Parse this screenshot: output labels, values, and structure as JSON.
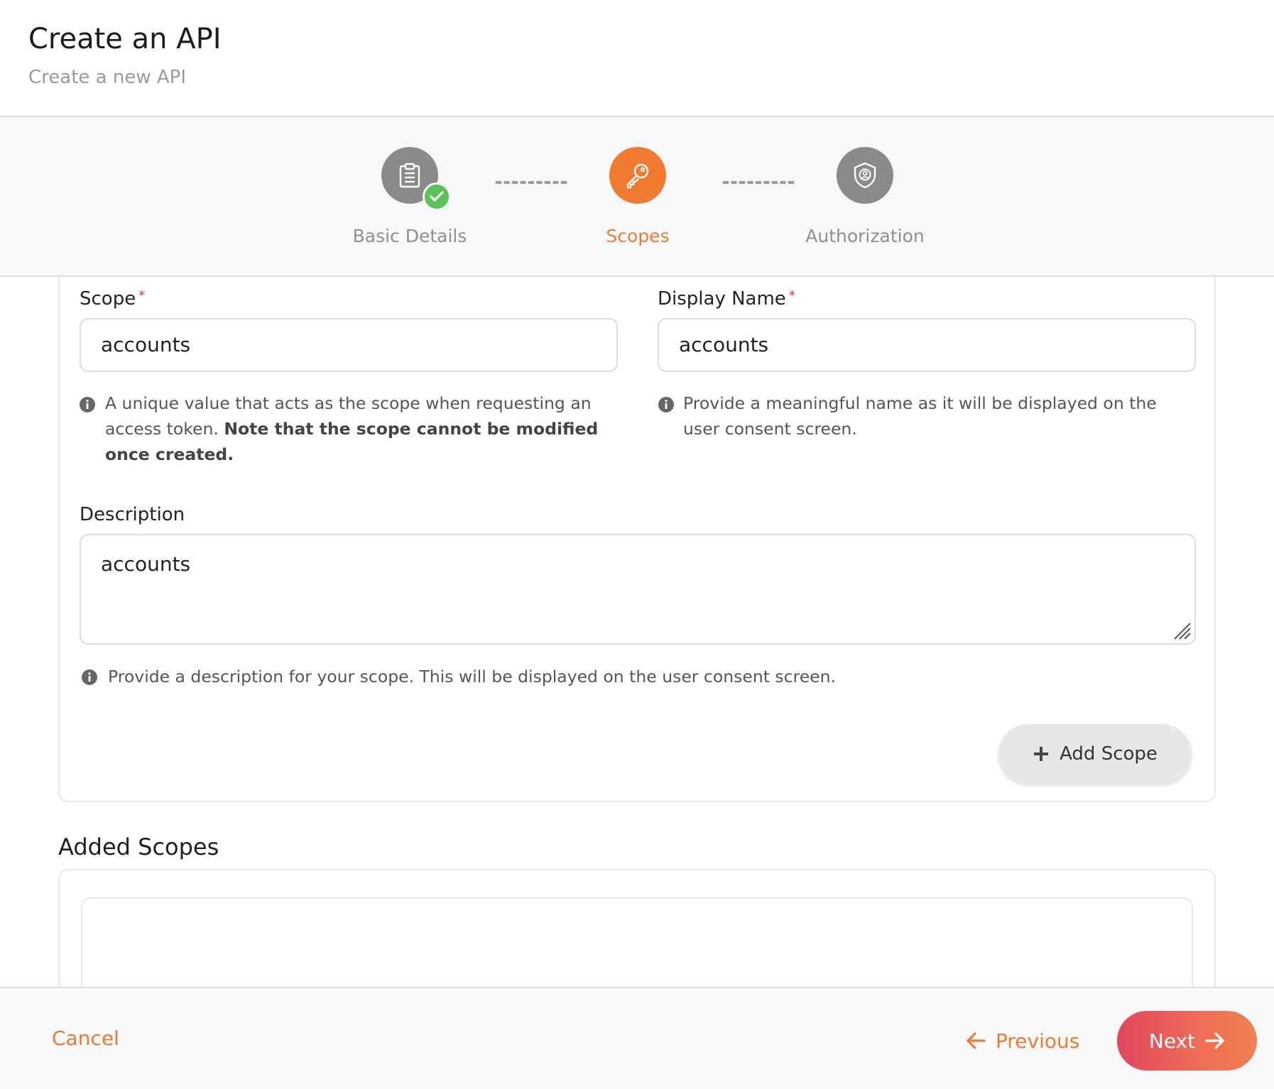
{
  "header": {
    "title": "Create an API",
    "subtitle": "Create a new API"
  },
  "stepper": {
    "steps": [
      {
        "label": "Basic Details",
        "state": "completed",
        "icon": "clipboard-icon"
      },
      {
        "label": "Scopes",
        "state": "active",
        "icon": "key-icon"
      },
      {
        "label": "Authorization",
        "state": "pending",
        "icon": "shield-user-icon"
      }
    ]
  },
  "form": {
    "scope": {
      "label": "Scope",
      "required_mark": "*",
      "value": "accounts",
      "hint_text": "A unique value that acts as the scope when requesting an access token. ",
      "hint_bold": "Note that the scope cannot be modified once created."
    },
    "display_name": {
      "label": "Display Name",
      "required_mark": "*",
      "value": "accounts",
      "hint_text": "Provide a meaningful name as it will be displayed on the user consent screen."
    },
    "description": {
      "label": "Description",
      "value": "accounts",
      "hint_text": "Provide a description for your scope. This will be displayed on the user consent screen."
    },
    "add_scope_label": "Add Scope"
  },
  "added_scopes": {
    "title": "Added Scopes"
  },
  "footer": {
    "cancel_label": "Cancel",
    "previous_label": "Previous",
    "next_label": "Next"
  },
  "colors": {
    "accent": "#f07b30",
    "success": "#5cc157",
    "step_inactive": "#8a8a8a",
    "next_gradient_start": "#e2455e",
    "next_gradient_end": "#f08150"
  }
}
